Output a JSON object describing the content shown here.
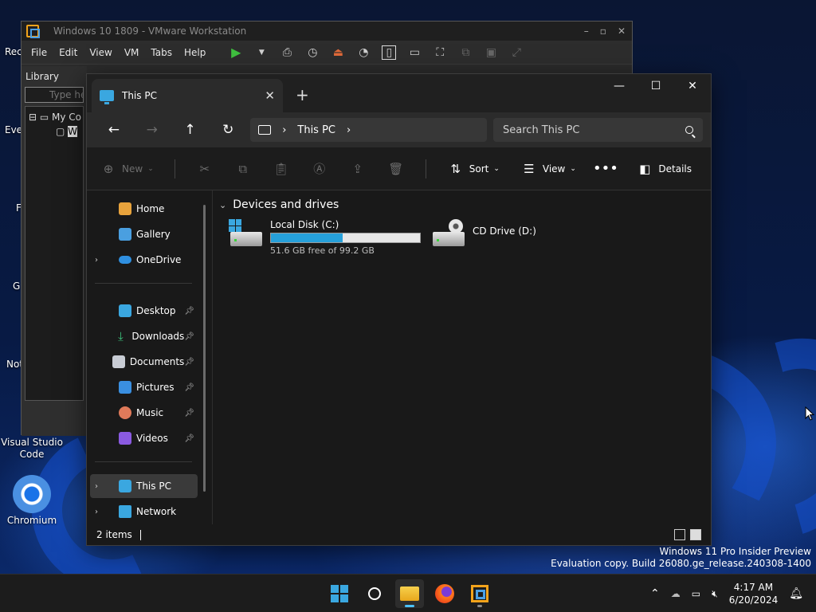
{
  "desktop": {
    "icons": [
      {
        "label": "Visual Studio\nCode"
      },
      {
        "label": "Chromium"
      }
    ],
    "edge_labels": [
      "Rec",
      "Eve",
      "F",
      "G",
      "Not"
    ]
  },
  "vmware": {
    "title": "Windows 10 1809 - VMware Workstation",
    "menu": [
      "File",
      "Edit",
      "View",
      "VM",
      "Tabs",
      "Help"
    ],
    "library_label": "Library",
    "search_placeholder": "Type he",
    "tree": [
      "My Co",
      "W"
    ]
  },
  "explorer": {
    "tab_title": "This PC",
    "address_crumb": "This PC",
    "search_placeholder": "Search This PC",
    "toolbar": {
      "new": "New",
      "sort": "Sort",
      "view": "View",
      "details": "Details"
    },
    "sidebar": {
      "items": [
        {
          "label": "Home",
          "icon": "home-icon",
          "color": "#e8a33c"
        },
        {
          "label": "Gallery",
          "icon": "gallery-icon",
          "color": "#4a9fe0"
        },
        {
          "label": "OneDrive",
          "icon": "cloud-icon",
          "color": "#2f8fe0"
        },
        {
          "label": "Desktop",
          "icon": "desktop-icon",
          "color": "#3aa7e0"
        },
        {
          "label": "Downloads",
          "icon": "download-icon",
          "color": "#3bbf7a"
        },
        {
          "label": "Documents",
          "icon": "document-icon",
          "color": "#c8ccd4"
        },
        {
          "label": "Pictures",
          "icon": "pictures-icon",
          "color": "#3a8fe0"
        },
        {
          "label": "Music",
          "icon": "music-icon",
          "color": "#e07a5a"
        },
        {
          "label": "Videos",
          "icon": "videos-icon",
          "color": "#8a5ae0"
        },
        {
          "label": "This PC",
          "icon": "computer-icon",
          "color": "#3aa7e0"
        },
        {
          "label": "Network",
          "icon": "network-icon",
          "color": "#3aa7e0"
        }
      ]
    },
    "group_title": "Devices and drives",
    "drives": [
      {
        "name": "Local Disk (C:)",
        "free": "51.6 GB free of 99.2 GB",
        "used_fraction": 0.48
      },
      {
        "name": "CD Drive (D:)"
      }
    ],
    "status": "2 items"
  },
  "watermark": {
    "line1": "Windows 11 Pro Insider Preview",
    "line2": "Evaluation copy. Build 26080.ge_release.240308-1400"
  },
  "taskbar": {
    "time": "4:17 AM",
    "date": "6/20/2024"
  },
  "colors": {
    "accent": "#26a0da",
    "explorer_bg": "#191919",
    "vmware_logo": "#f2a31b"
  }
}
